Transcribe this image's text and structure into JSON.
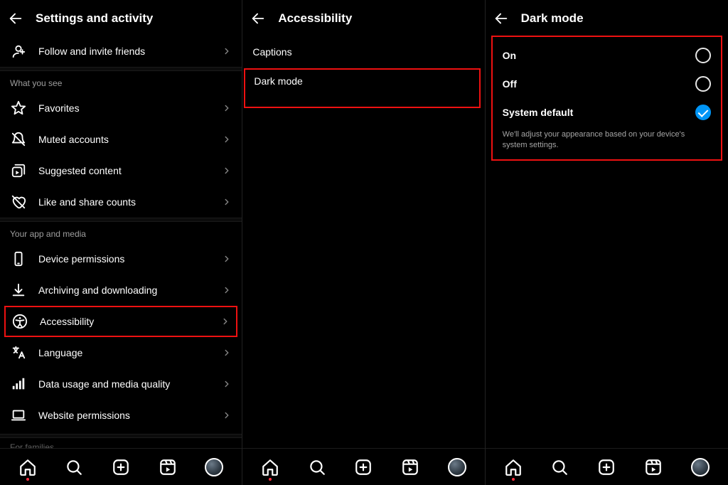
{
  "pane1": {
    "title": "Settings and activity",
    "follow": "Follow and invite friends",
    "section_what_you_see": "What you see",
    "favorites": "Favorites",
    "muted": "Muted accounts",
    "suggested": "Suggested content",
    "likeshare": "Like and share counts",
    "section_app_media": "Your app and media",
    "device": "Device permissions",
    "archiving": "Archiving and downloading",
    "accessibility": "Accessibility",
    "language": "Language",
    "datausage": "Data usage and media quality",
    "website": "Website permissions",
    "section_for_families": "For families"
  },
  "pane2": {
    "title": "Accessibility",
    "captions": "Captions",
    "darkmode": "Dark mode"
  },
  "pane3": {
    "title": "Dark mode",
    "on": "On",
    "off": "Off",
    "system": "System default",
    "helper": "We'll adjust your appearance based on your device's system settings."
  },
  "selected_dark_mode": "system"
}
